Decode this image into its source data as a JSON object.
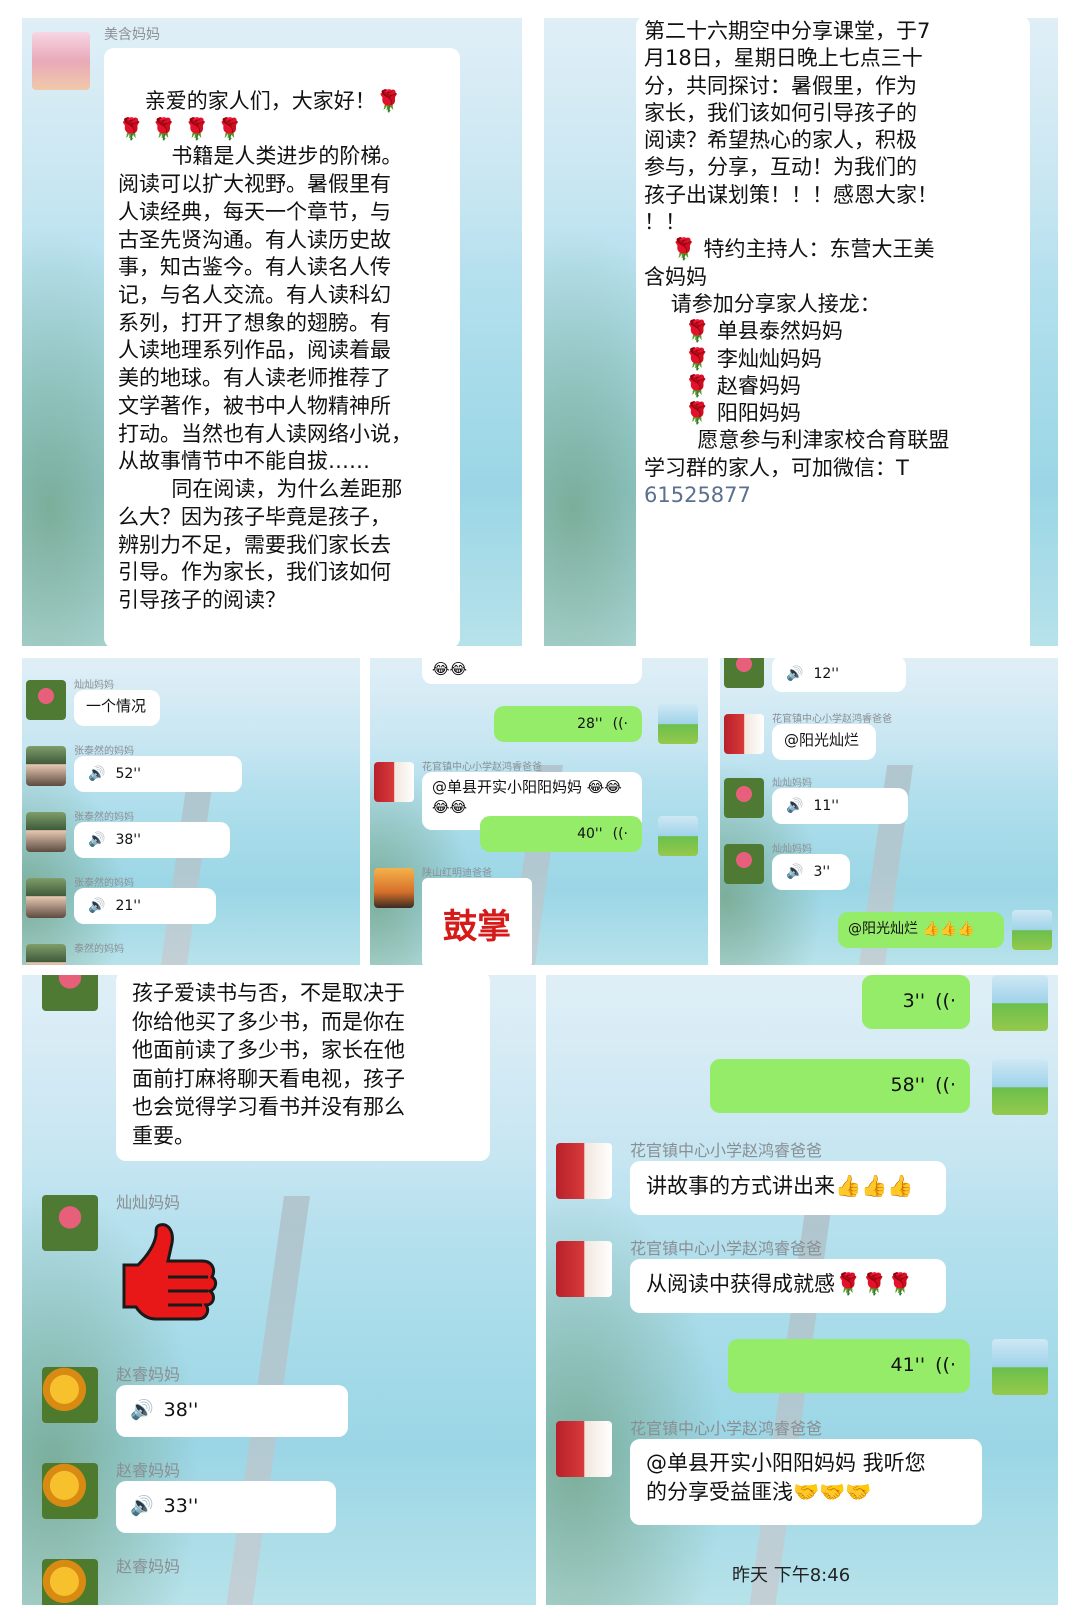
{
  "panel1": {
    "sender": "美含妈妈",
    "lines": [
      "    亲爱的家人们，大家好！🌹",
      "🌹 🌹 🌹 🌹",
      "        书籍是人类进步的阶梯。",
      "阅读可以扩大视野。暑假里有",
      "人读经典，每天一个章节，与",
      "古圣先贤沟通。有人读历史故",
      "事，知古鉴今。有人读名人传",
      "记，与名人交流。有人读科幻",
      "系列，打开了想象的翅膀。有",
      "人读地理系列作品，阅读着最",
      "美的地球。有人读老师推荐了",
      "文学著作，被书中人物精神所",
      "打动。当然也有人读网络小说，",
      "从故事情节中不能自拔……",
      "        同在阅读，为什么差距那",
      "么大？因为孩子毕竟是孩子，",
      "辨别力不足，需要我们家长去",
      "引导。作为家长，我们该如何",
      "引导孩子的阅读？"
    ]
  },
  "panel2": {
    "lines": [
      "第二十六期空中分享课堂，于7",
      "月18日，星期日晚上七点三十",
      "分，共同探讨：暑假里，作为",
      "家长，我们该如何引导孩子的",
      "阅读？希望热心的家人，积极",
      "参与，分享，互动！为我们的",
      "孩子出谋划策！！！感恩大家！",
      "！！",
      "    🌹 特约主持人：东营大王美",
      "含妈妈",
      "    请参加分享家人接龙：",
      "      🌹 单县泰然妈妈",
      "      🌹 李灿灿妈妈",
      "      🌹 赵睿妈妈",
      "      🌹 阳阳妈妈",
      "        愿意参与利津家校合育联盟",
      "学习群的家人，可加微信：T"
    ],
    "wechat_id": "61525877"
  },
  "panel3": {
    "msgs": [
      {
        "name": "灿灿妈妈",
        "text": "一个情况"
      },
      {
        "name": "张泰然的妈妈",
        "text": "52''"
      },
      {
        "name": "张泰然的妈妈",
        "text": "38''"
      },
      {
        "name": "张泰然的妈妈",
        "text": "21''"
      },
      {
        "name": "泰然的妈妈",
        "text": ""
      }
    ]
  },
  "panel4": {
    "top_emoji": "😂😂",
    "voice1": "28''",
    "sender1": "花官镇中心小学赵鸿睿爸爸",
    "text1": "@单县开实小阳阳妈妈 😂😂",
    "text1b": "😂😂",
    "voice2": "40''",
    "sender2": "陕山红明迪爸爸",
    "clap": "鼓掌"
  },
  "panel5": {
    "voice0": "12''",
    "sender1": "花官镇中心小学赵鸿睿爸爸",
    "text1": "@阳光灿烂",
    "sender2": "灿灿妈妈",
    "voice2": "11''",
    "sender3": "灿灿妈妈",
    "voice3": "3''",
    "text4": "@阳光灿烂 👍👍👍"
  },
  "panel6": {
    "lines": [
      "孩子爱读书与否，不是取决于",
      "你给他买了多少书，而是你在",
      "他面前读了多少书，家长在他",
      "面前打麻将聊天看电视，孩子",
      "也会觉得学习看书并没有那么",
      "重要。"
    ],
    "sender1": "灿灿妈妈",
    "sender2": "赵睿妈妈",
    "voice2": "38''",
    "sender3": "赵睿妈妈",
    "voice3": "33''",
    "sender4": "赵睿妈妈"
  },
  "panel7": {
    "voice1": "3''",
    "voice2": "58''",
    "sender1": "花官镇中心小学赵鸿睿爸爸",
    "text1": "讲故事的方式讲出来👍👍👍",
    "sender2": "花官镇中心小学赵鸿睿爸爸",
    "text2": "从阅读中获得成就感🌹🌹🌹",
    "voice3": "41''",
    "sender3": "花官镇中心小学赵鸿睿爸爸",
    "text3a": "@单县开实小阳阳妈妈  我听您",
    "text3b": "的分享受益匪浅🤝🤝🤝",
    "timestamp": "昨天 下午8:46"
  }
}
